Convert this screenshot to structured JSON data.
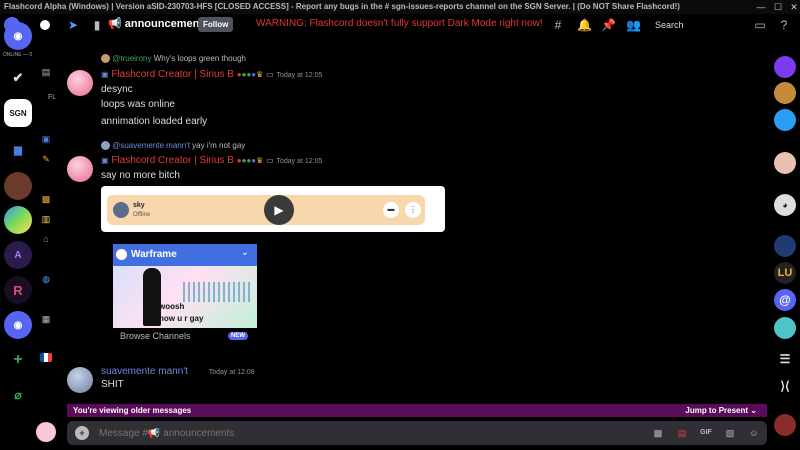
{
  "titlebar": {
    "text": "Flashcord Alpha (Windows) | Version aSID-230703-HFS [CLOSED ACCESS] - Report any bugs in the # sgn-issues-reports channel on the SGN Server. | (Do NOT Share Flashcord!)"
  },
  "header": {
    "channel": "📢 announcements",
    "follow": "Follow",
    "warning": "WARNING: Flashcord doesn't fully support Dark Mode right now!",
    "search_placeholder": "Search"
  },
  "rail": {
    "online_label": "ONLINE — 0",
    "sgn_label": "SGN",
    "fl_label": "FL"
  },
  "messages": {
    "m1": {
      "reply_user": "@trueirony",
      "reply_text": "Why's loops green though",
      "author": "Flashcord Creator | Sirius B",
      "time": "Today at 12:05",
      "lines": [
        "desync",
        "loops was online",
        "annimation loaded early"
      ]
    },
    "m2": {
      "reply_user": "@suavemente mann't",
      "reply_text": "yay i'm not gay",
      "author": "Flashcord Creator | Sirius B",
      "time": "Today at 12:05",
      "line": "say no more bitch"
    },
    "spotify": {
      "user": "sky",
      "status": "Offline"
    },
    "warframe": {
      "title": "Warframe",
      "woosh": "woosh",
      "caption": "now u r gay",
      "browse": "Browse Channels",
      "new_badge": "NEW"
    },
    "m3": {
      "author": "suavemente mann't",
      "time": "Today at 12:08",
      "line": "SHIT"
    }
  },
  "older_bar": {
    "text": "You're viewing older messages",
    "jump": "Jump to Present"
  },
  "composer": {
    "placeholder": "Message #📢 announcements"
  },
  "colors": {
    "accent_red": "#e03b3b",
    "blurple": "#5865f2",
    "older_bar": "#5a0b5a"
  }
}
